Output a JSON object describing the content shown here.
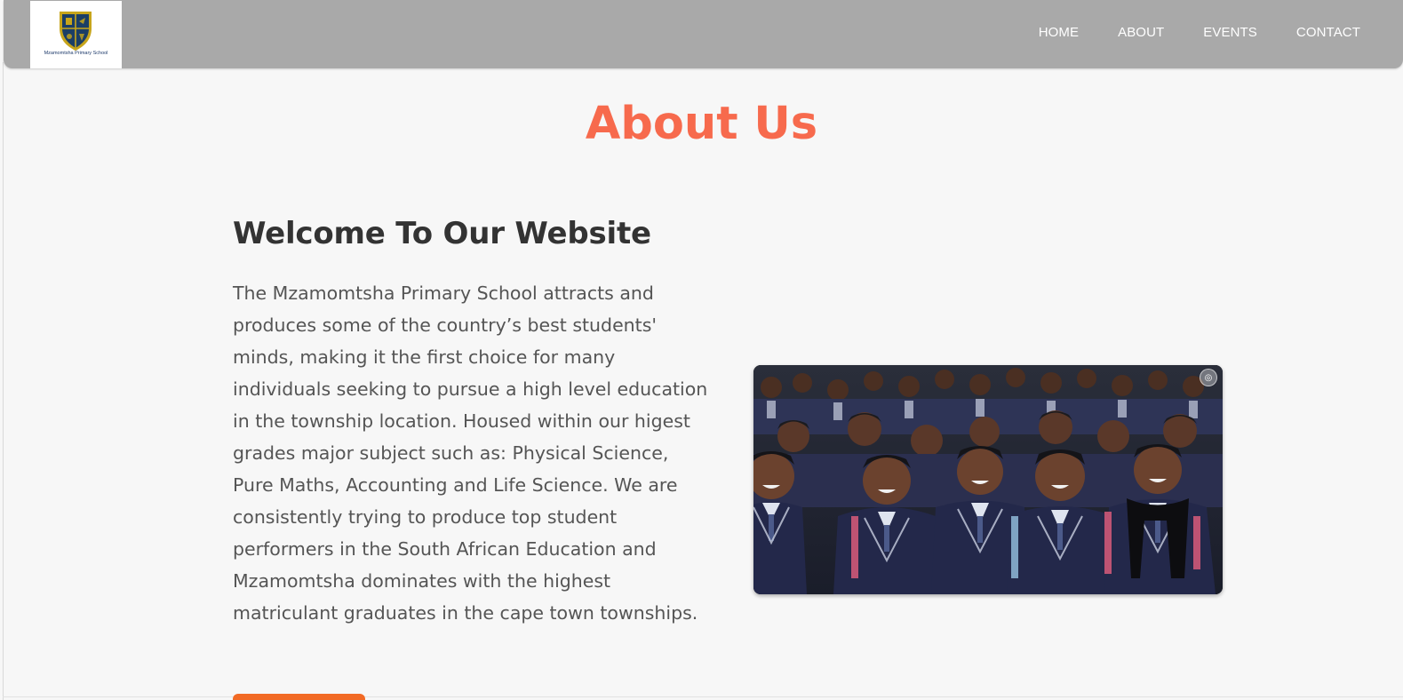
{
  "nav": {
    "logo_caption": "Mzamomtsha Primary School",
    "links": [
      {
        "label": "HOME"
      },
      {
        "label": "ABOUT"
      },
      {
        "label": "EVENTS"
      },
      {
        "label": "CONTACT"
      }
    ]
  },
  "about": {
    "page_title": "About Us",
    "heading": "Welcome To Our Website",
    "paragraph": "The Mzamomtsha Primary School attracts and produces some of the country’s best students' minds, making it the first choice for many individuals seeking to pursue a high level education in the township location. Housed within our higest grades major subject such as: Physical Science, Pure Maths, Accounting and Life Science. We are consistently trying to produce top student performers in the South African Education and Mzamomtsha dominates with the highest matriculant graduates in the cape town townships.",
    "image_icon": "visual-search-icon"
  },
  "colors": {
    "navbar_bg": "#a9a9a9",
    "title_accent": "#f76a4d",
    "button_accent": "#f26a25",
    "heading_text": "#333333",
    "body_text": "#555555",
    "page_bg": "#f7f7f7"
  },
  "icons": {
    "logo": "school-crest-icon",
    "image_lens": "visual-search-icon"
  }
}
